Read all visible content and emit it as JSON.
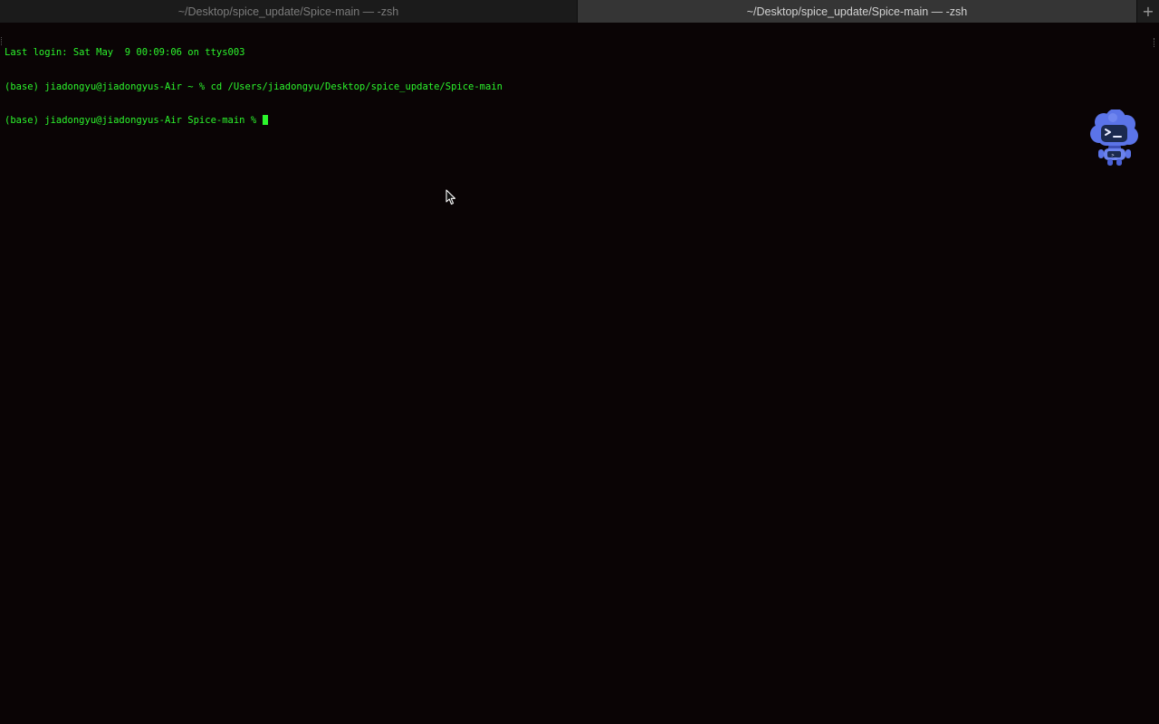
{
  "tabs": [
    {
      "label": "~/Desktop/spice_update/Spice-main — -zsh",
      "active": false
    },
    {
      "label": "~/Desktop/spice_update/Spice-main — -zsh",
      "active": true
    }
  ],
  "new_tab_label": "+",
  "terminal": {
    "lines": [
      "Last login: Sat May  9 00:09:06 on ttys003",
      "(base) jiadongyu@jiadongyus-Air ~ % cd /Users/jiadongyu/Desktop/spice_update/Spice-main",
      "(base) jiadongyu@jiadongyus-Air Spice-main % "
    ],
    "text_color": "#2cf52c",
    "background": "#0a0405"
  },
  "icons": {
    "mascot": "terminal-robot-mascot-icon",
    "pointer": "mouse-pointer-icon",
    "new_tab": "plus-icon"
  }
}
